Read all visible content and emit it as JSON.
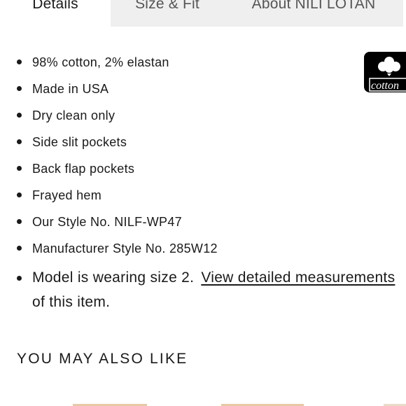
{
  "tabs": {
    "details": "Details",
    "size_fit": "Size & Fit",
    "about": "About NILI LOTAN"
  },
  "badge": {
    "icon": "cotton-logo-icon",
    "text": "cotton"
  },
  "details": [
    "98% cotton, 2% elastan",
    "Made in USA",
    "Dry clean only",
    "Side slit pockets",
    "Back flap pockets",
    "Frayed hem",
    "Our Style No. NILF-WP47",
    "Manufacturer Style No. 285W12"
  ],
  "model_note": {
    "text": "Model is wearing size 2.",
    "link": "View detailed measurements",
    "continuation": "of this item."
  },
  "recommendations": {
    "heading": "YOU MAY ALSO LIKE"
  },
  "colors": {
    "tab_inactive_bg": "#efefef",
    "text": "#1a1a1a",
    "thumb": "#e8c9a6"
  }
}
